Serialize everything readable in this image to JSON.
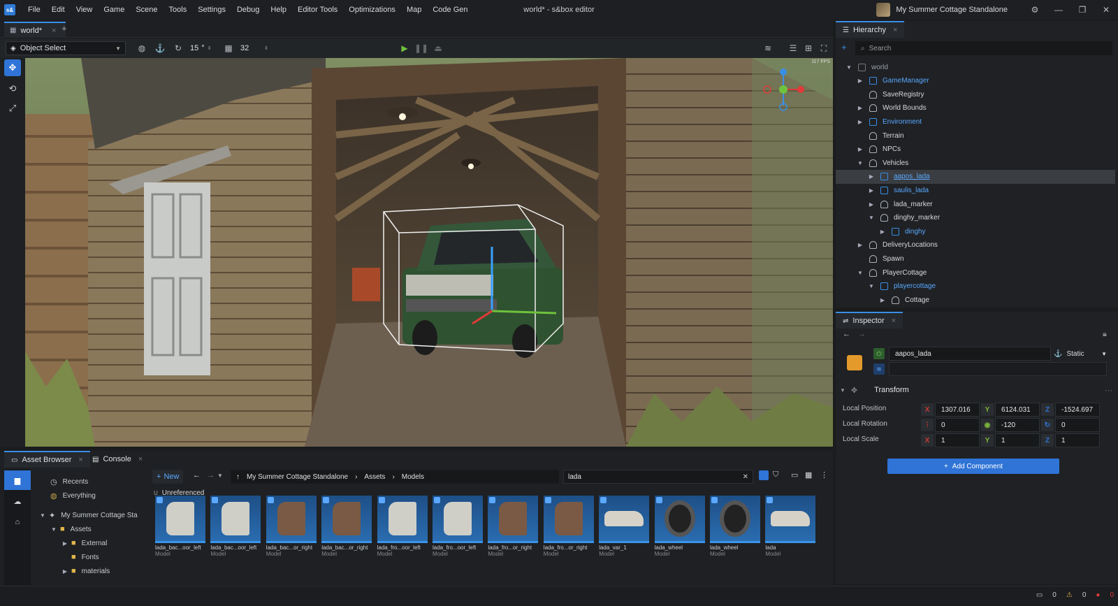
{
  "app": {
    "logo": "s&",
    "window_title": "world* - s&box editor",
    "project_name": "My Summer Cottage Standalone"
  },
  "menu": [
    "File",
    "Edit",
    "View",
    "Game",
    "Scene",
    "Tools",
    "Settings",
    "Debug",
    "Help",
    "Editor Tools",
    "Optimizations",
    "Map",
    "Code Gen"
  ],
  "document_tab": {
    "label": "world*"
  },
  "toolbar": {
    "select_mode": "Object Select",
    "rotation_snap": "15",
    "rotation_unit": "°",
    "grid_size": "32"
  },
  "viewport": {
    "fps": "117 FPS"
  },
  "bottom_tabs": [
    "Asset Browser",
    "Console"
  ],
  "asset_browser": {
    "new_label": "New",
    "breadcrumb": [
      "My Summer Cottage Standalone",
      "Assets",
      "Models"
    ],
    "search_value": "lada",
    "filter_chip": "Unreferenced",
    "filter_chip_key": "U",
    "tree": [
      {
        "label": "Recents"
      },
      {
        "label": "Everything"
      },
      {
        "label": "My Summer Cottage Sta"
      },
      {
        "label": "Assets"
      },
      {
        "label": "External"
      },
      {
        "label": "Fonts"
      },
      {
        "label": "materials"
      }
    ],
    "assets": [
      {
        "name": "lada_bac...oor_left",
        "type": "Model"
      },
      {
        "name": "lada_bac...oor_left",
        "type": "Model"
      },
      {
        "name": "lada_bac...or_right",
        "type": "Model"
      },
      {
        "name": "lada_bac...or_right",
        "type": "Model"
      },
      {
        "name": "lada_fro...oor_left",
        "type": "Model"
      },
      {
        "name": "lada_fro...oor_left",
        "type": "Model"
      },
      {
        "name": "lada_fro...or_right",
        "type": "Model"
      },
      {
        "name": "lada_fro...or_right",
        "type": "Model"
      },
      {
        "name": "lada_var_1",
        "type": "Model"
      },
      {
        "name": "lada_wheel",
        "type": "Model"
      },
      {
        "name": "lada_wheel",
        "type": "Model"
      },
      {
        "name": "lada",
        "type": "Model"
      }
    ]
  },
  "hierarchy": {
    "tab": "Hierarchy",
    "search_placeholder": "Search",
    "items": [
      {
        "label": "world",
        "kind": "root"
      },
      {
        "label": "GameManager",
        "kind": "prefab"
      },
      {
        "label": "SaveRegistry",
        "kind": "object"
      },
      {
        "label": "World Bounds",
        "kind": "object"
      },
      {
        "label": "Environment",
        "kind": "script"
      },
      {
        "label": "Terrain",
        "kind": "object"
      },
      {
        "label": "NPCs",
        "kind": "object"
      },
      {
        "label": "Vehicles",
        "kind": "object"
      },
      {
        "label": "aapos_lada",
        "kind": "prefab"
      },
      {
        "label": "saulis_lada",
        "kind": "prefab"
      },
      {
        "label": "lada_marker",
        "kind": "object"
      },
      {
        "label": "dinghy_marker",
        "kind": "object"
      },
      {
        "label": "dinghy",
        "kind": "script"
      },
      {
        "label": "DeliveryLocations",
        "kind": "object"
      },
      {
        "label": "Spawn",
        "kind": "object"
      },
      {
        "label": "PlayerCottage",
        "kind": "object"
      },
      {
        "label": "playercottage",
        "kind": "prefab"
      },
      {
        "label": "Cottage",
        "kind": "object"
      }
    ]
  },
  "inspector": {
    "tab": "Inspector",
    "object_name": "aapos_lada",
    "static_label": "Static",
    "component": "Transform",
    "rows": [
      {
        "label": "Local Position",
        "values": [
          "1307.016",
          "6124.031",
          "-1524.697"
        ],
        "axes": [
          "X",
          "Y",
          "Z"
        ]
      },
      {
        "label": "Local Rotation",
        "values": [
          "0",
          "-120",
          "0"
        ],
        "axes": [
          "",
          "",
          ""
        ]
      },
      {
        "label": "Local Scale",
        "values": [
          "1",
          "1",
          "1"
        ],
        "axes": [
          "X",
          "Y",
          "Z"
        ]
      }
    ],
    "add_component": "Add Component"
  },
  "status": {
    "messages": "0",
    "warnings": "0",
    "errors": "0"
  },
  "colors": {
    "accent": "#3a8ee6",
    "prefab_text": "#5aa8ff",
    "button": "#2f74d6",
    "x_axis": "#c73a3a",
    "y_axis": "#7cb83a",
    "z_axis": "#2f74d6"
  }
}
